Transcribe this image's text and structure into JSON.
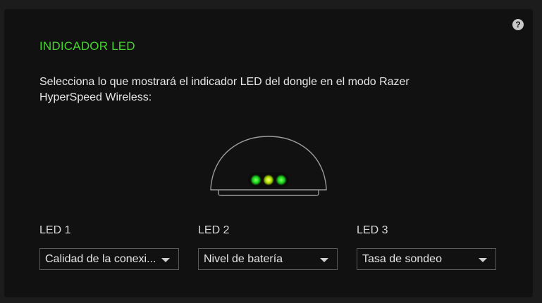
{
  "help_icon": {
    "glyph": "?",
    "icon": "help-icon"
  },
  "section": {
    "title": "INDICADOR LED",
    "description": "Selecciona lo que mostrará el indicador LED del dongle en el modo Razer HyperSpeed Wireless:"
  },
  "colors": {
    "accent": "#44d62c",
    "led_green": "#22dd22",
    "led_yellow_green": "#b8e600",
    "panel_bg": "#111111"
  },
  "leds": [
    {
      "label": "LED 1",
      "value": "Calidad de la conexión",
      "display_value": "Calidad de la conexi..."
    },
    {
      "label": "LED 2",
      "value": "Nivel de batería",
      "display_value": "Nivel de batería"
    },
    {
      "label": "LED 3",
      "value": "Tasa de sondeo",
      "display_value": "Tasa de sondeo"
    }
  ]
}
